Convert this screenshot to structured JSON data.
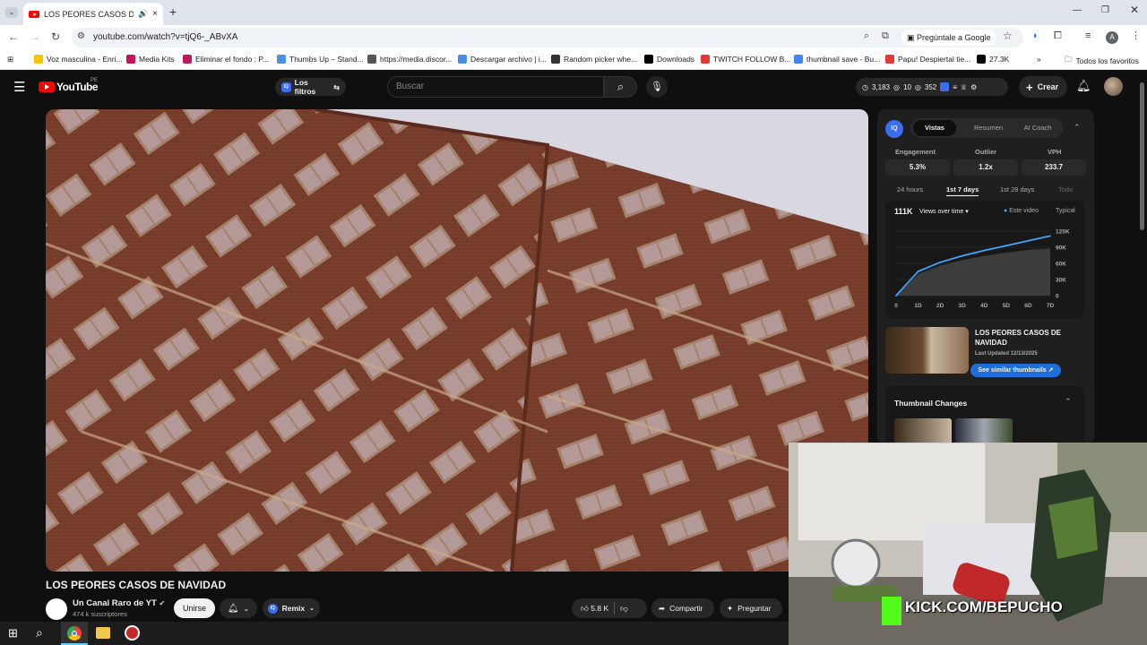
{
  "browser": {
    "tab_title": "LOS PEORES CASOS DE NA",
    "new_tab": "+",
    "url": "youtube.com/watch?v=tjQ6-_ABvXA",
    "ask_google": "Pregúntale a Google",
    "profile_letter": "A",
    "bookmarks": [
      {
        "label": "Voz masculina - Enri...",
        "color": "#f5c400"
      },
      {
        "label": "Media Kits",
        "color": "#c2185b"
      },
      {
        "label": "Eliminar el fondo : P...",
        "color": "#c2185b"
      },
      {
        "label": "Thumbs Up – Stand...",
        "color": "#4a90e2"
      },
      {
        "label": "https://media.discor...",
        "color": "#555555"
      },
      {
        "label": "Descargar archivo | i...",
        "color": "#4a90e2"
      },
      {
        "label": "Random picker whe...",
        "color": "#333333"
      },
      {
        "label": "Downloads",
        "color": "#000000"
      },
      {
        "label": "TWITCH FOLLOW B...",
        "color": "#e53935"
      },
      {
        "label": "thumbnail save - Bu...",
        "color": "#4285f4"
      },
      {
        "label": "Papu! Despiertal tie...",
        "color": "#e53935"
      },
      {
        "label": "27.3K",
        "color": "#000000"
      }
    ],
    "all_favorites": "Todos los favoritos"
  },
  "youtube": {
    "logo": "YouTube",
    "country": "PE",
    "filters": "Los filtros",
    "search_placeholder": "Buscar",
    "stats": {
      "a": "3,183",
      "b": "10",
      "c": "352"
    },
    "create": "Crear"
  },
  "video": {
    "title": "LOS PEORES CASOS DE NAVIDAD",
    "channel": "Un Canal Raro de YT",
    "subscribers": "474 k suscriptores",
    "join": "Unirse",
    "remix": "Remix",
    "likes": "5.8 K",
    "share": "Compartir",
    "ask": "Preguntar"
  },
  "panel": {
    "badge": "IQ",
    "tabs": [
      "Vistas",
      "Resumen",
      "AI Coach"
    ],
    "metric_labels": [
      "Engagement",
      "Outlier",
      "VPH"
    ],
    "metric_values": [
      "5.3%",
      "1.2x",
      "233.7"
    ],
    "ranges": [
      "24 hours",
      "1st 7 days",
      "1st 28 days",
      "Todo"
    ],
    "views_total": "111K",
    "views_selector": "Views over time",
    "legend_this": "Este video",
    "legend_typical": "Typical",
    "card_title": "LOS PEORES CASOS DE NAVIDAD",
    "last_updated": "Last Updated 12/13/2025",
    "similar_button": "See similar thumbnails",
    "thumb_changes": "Thumbnail Changes"
  },
  "chart_data": {
    "type": "area",
    "x": [
      "0",
      "1D",
      "2D",
      "3D",
      "4D",
      "5D",
      "6D",
      "7D"
    ],
    "y_ticks": [
      "120K",
      "90K",
      "60K",
      "30K",
      "0"
    ],
    "ylim": [
      0,
      120000
    ],
    "series": [
      {
        "name": "Este video",
        "values": [
          0,
          45000,
          62000,
          74000,
          84000,
          93000,
          102000,
          111000
        ],
        "color": "#3ea6ff"
      },
      {
        "name": "Typical",
        "values": [
          0,
          40000,
          56000,
          66000,
          74000,
          80000,
          85000,
          88000
        ],
        "color": "#555555"
      }
    ]
  },
  "webcam": {
    "overlay": "KICK.COM/BEPUCHO"
  }
}
